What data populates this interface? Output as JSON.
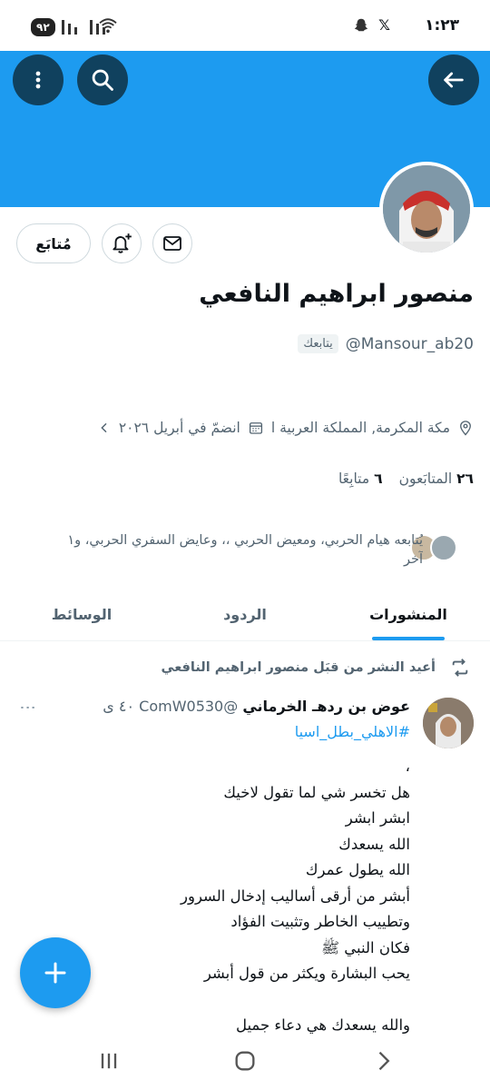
{
  "status_bar": {
    "time": "١:٢٣",
    "battery": "٩٢",
    "icons": [
      "snapchat-icon",
      "x-icon",
      "wifi-icon",
      "signal-icon"
    ]
  },
  "header": {
    "back_icon": "arrow-left-icon",
    "search_icon": "search-icon",
    "more_icon": "more-vertical-icon",
    "banner_color": "#1d9bf0"
  },
  "profile": {
    "name": "منصور ابراهيم النافعي",
    "handle": "@Mansour_ab20",
    "follows_you_label": "يتابعك",
    "follow_button_label": "مُتابَع",
    "location": "مكة المكرمة, المملكة العربية ا",
    "joined": "انضمّ في أبريل ٢٠٢٦",
    "following_count": "٦",
    "following_label": "متابِعًا",
    "followers_count": "٢٦",
    "followers_label": "المتابَعون",
    "followed_by_line1": "يُتابعه هيام الحربي، ومعيض الحربي ،، وعايض السفري الحربي، و١",
    "followed_by_line2": "آخر"
  },
  "tabs": [
    {
      "label": "المنشورات",
      "active": true
    },
    {
      "label": "الردود",
      "active": false
    },
    {
      "label": "الوسائط",
      "active": false
    }
  ],
  "tweet": {
    "repost_label": "أعيد النشر من قبَل منصور ابراهيم النافعي",
    "author": "عوض بن ردهـ الخرماني",
    "author_handle": "@ComW0530",
    "time": "٤٠ ى",
    "hashtag": "#الاهلي_بطل_اسيا",
    "body": "،\nهل تخسر شي لما تقول لاخيك\nابشر ابشر\nالله يسعدك\nالله يطول عمرك\nأبشر من أرقى أساليب إدخال السرور\nوتطييب الخاطر وتثبيت الفؤاد\nفكان النبي ﷺ\nيحب البشارة ويكثر من قول أبشر\n\nوالله يسعدك هي دعاء جميل"
  },
  "colors": {
    "accent": "#1d9bf0",
    "text": "#0f1419",
    "muted": "#536471",
    "header_button": "#10415e"
  }
}
